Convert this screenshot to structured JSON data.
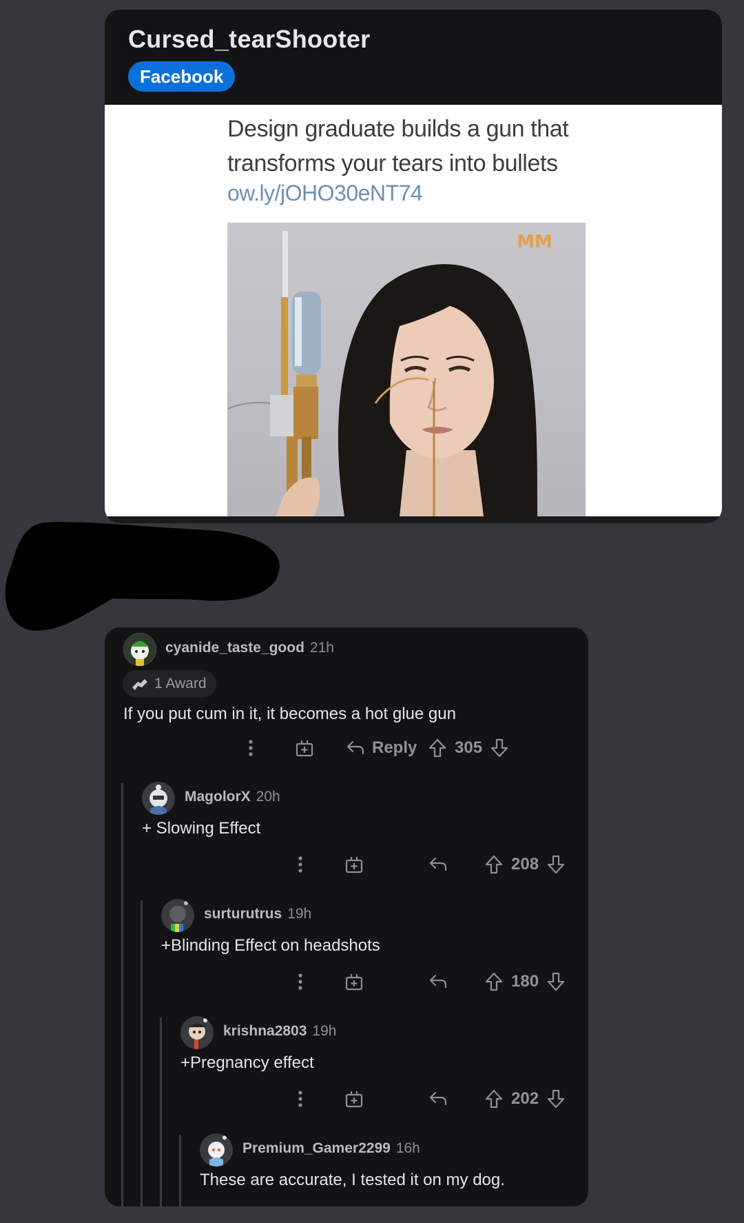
{
  "post": {
    "title": "Cursed_tearShooter",
    "flair": "Facebook",
    "headline": "Design graduate builds a gun that transforms your tears into bullets",
    "link": "ow.ly/jOHO30eNT74",
    "watermark": "MM"
  },
  "comments": [
    {
      "user": "cyanide_taste_good",
      "time": "21h",
      "award": "1 Award",
      "text": "If you put cum in it, it becomes a hot glue gun",
      "reply_label": "Reply",
      "score": "305"
    },
    {
      "user": "MagolorX",
      "time": "20h",
      "text": "+ Slowing Effect",
      "score": "208"
    },
    {
      "user": "surturutrus",
      "time": "19h",
      "text": "+Blinding Effect on headshots",
      "score": "180"
    },
    {
      "user": "krishna2803",
      "time": "19h",
      "text": "+Pregnancy effect",
      "score": "202"
    },
    {
      "user": "Premium_Gamer2299",
      "time": "16h",
      "text": "These are accurate, I tested it on my dog."
    }
  ],
  "icons": {
    "more": "more-vertical-icon",
    "award": "gift-award-icon",
    "reply": "reply-arrow-icon",
    "upvote": "upvote-arrow-icon",
    "downvote": "downvote-arrow-icon"
  },
  "colors": {
    "background": "#36373c",
    "card": "#141416",
    "flair": "#0c70d8",
    "link": "#6d8fb0"
  }
}
